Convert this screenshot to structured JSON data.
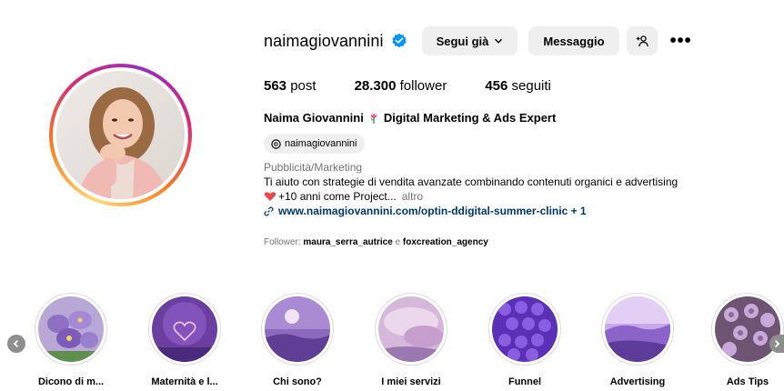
{
  "profile": {
    "username": "naimagiovannini",
    "follow_label": "Segui già",
    "message_label": "Messaggio",
    "more_label": "•••",
    "stats": {
      "posts_value": "563",
      "posts_label": "post",
      "followers_value": "28.300",
      "followers_label": "follower",
      "following_value": "456",
      "following_label": "seguiti"
    },
    "full_name": "Naima Giovannini",
    "headline": "Digital Marketing & Ads Expert",
    "threads_handle": "naimagiovannini",
    "category": "Pubblicità/Marketing",
    "bio_line1": "Ti aiuto con strategie di vendita avanzate combinando contenuti organici e advertising",
    "bio_line2": "+10 anni come Project...",
    "bio_more": "altro",
    "link": "www.naimagiovannini.com/optin-ddigital-summer-clinic + 1",
    "followed_by_prefix": "Follower:",
    "followed_by_1": "maura_serra_autrice",
    "followed_by_sep": "e",
    "followed_by_2": "foxcreation_agency"
  },
  "highlights": [
    {
      "label": "Dicono di m..."
    },
    {
      "label": "Maternità e l..."
    },
    {
      "label": "Chi sono?"
    },
    {
      "label": "I miei servizi"
    },
    {
      "label": "Funnel"
    },
    {
      "label": "Advertising"
    },
    {
      "label": "Ads Tips"
    }
  ],
  "colors": {
    "verified": "#0095f6",
    "link": "#00376b",
    "secondary_text": "#737373",
    "button_bg": "#efefef"
  }
}
